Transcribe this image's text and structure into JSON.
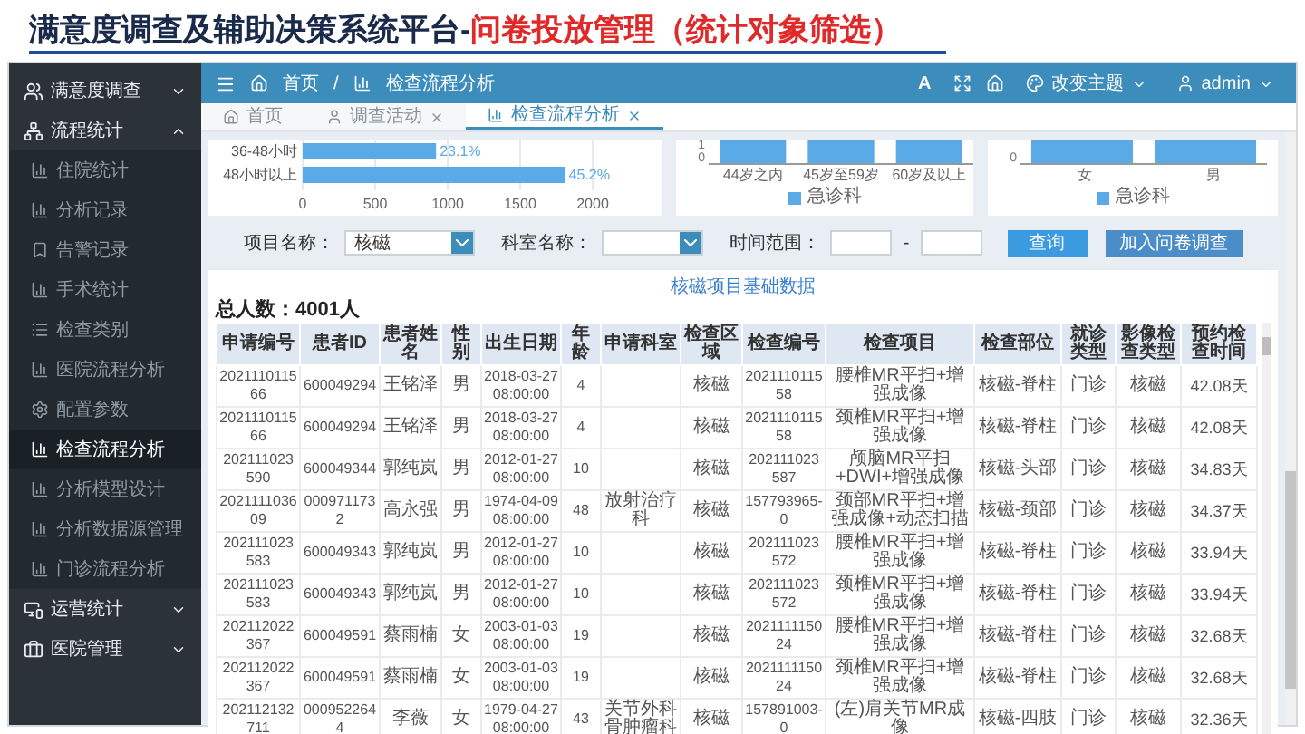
{
  "slide_title": {
    "text": "满意度调查及辅助决策系统平台-",
    "highlight": "问卷投放管理（统计对象筛选）"
  },
  "sidebar": {
    "items": [
      {
        "label": "满意度调查",
        "expanded": false
      },
      {
        "label": "流程统计",
        "expanded": true,
        "children": [
          {
            "label": "住院统计",
            "selected": false
          },
          {
            "label": "分析记录",
            "selected": false
          },
          {
            "label": "告警记录",
            "selected": false
          },
          {
            "label": "手术统计",
            "selected": false
          },
          {
            "label": "检查类别",
            "selected": false
          },
          {
            "label": "医院流程分析",
            "selected": false
          },
          {
            "label": "配置参数",
            "selected": false
          },
          {
            "label": "检查流程分析",
            "selected": true
          },
          {
            "label": "分析模型设计",
            "selected": false
          },
          {
            "label": "分析数据源管理",
            "selected": false
          },
          {
            "label": "门诊流程分析",
            "selected": false
          }
        ]
      },
      {
        "label": "运营统计",
        "expanded": false
      },
      {
        "label": "医院管理",
        "expanded": false
      }
    ]
  },
  "header": {
    "breadcrumb": [
      "首页",
      "检查流程分析"
    ],
    "separator": "/",
    "font_button": "A",
    "theme_menu": "改变主题",
    "user_menu": "admin"
  },
  "tabs": [
    {
      "label": "首页",
      "selected": false,
      "closable": false
    },
    {
      "label": "调查活动",
      "selected": false,
      "closable": true
    },
    {
      "label": "检查流程分析",
      "selected": true,
      "closable": true
    }
  ],
  "duration_chart": {
    "bar_labels": [
      "23.1%",
      "45.2%"
    ],
    "chart_data": {
      "type": "bar",
      "orientation": "horizontal",
      "grid": true,
      "categories": [
        "36-48小时",
        "48小时以上"
      ],
      "values": [
        920,
        1810
      ],
      "xlim": [
        0,
        2000
      ],
      "xticks": [
        0,
        500,
        1000,
        1500,
        2000
      ]
    }
  },
  "age_chart": {
    "axis_labels": [
      "1",
      "0"
    ],
    "categories": [
      "44岁之内",
      "45岁至59岁",
      "60岁及以上"
    ],
    "legend": "急诊科"
  },
  "sex_chart": {
    "axis_labels": [
      "0"
    ],
    "categories": [
      "女",
      "男"
    ],
    "legend": "急诊科"
  },
  "filters": {
    "project_label": "项目名称：",
    "project_value": "核磁",
    "dept_label": "科室名称：",
    "time_label": "时间范围：",
    "time_separator": "-",
    "search_button": "查询",
    "add_button": "加入问卷调查"
  },
  "table": {
    "title": "核磁项目基础数据",
    "total": "总人数：4001人",
    "columns": [
      "申请编号",
      "患者ID",
      "患者姓名",
      "性别",
      "出生日期",
      "年龄",
      "申请科室",
      "检查区域",
      "检查编号",
      "检查项目",
      "检查部位",
      "就诊类型",
      "影像检查类型",
      "预约检查时间"
    ],
    "rows": [
      {
        "request_no": "202111011566",
        "patient_id": "600049294",
        "name": "王铭泽",
        "sex": "男",
        "birth": "2018-03-27 08:00:00",
        "age": "4",
        "area": "核磁",
        "exam_no": "202111011558",
        "item": "腰椎MR平扫+增强成像",
        "part": "核磁-脊柱",
        "visit_type": "门诊",
        "modality": "核磁",
        "wait": "42.08天"
      },
      {
        "request_no": "202111011566",
        "patient_id": "600049294",
        "name": "王铭泽",
        "sex": "男",
        "birth": "2018-03-27 08:00:00",
        "age": "4",
        "area": "核磁",
        "exam_no": "202111011558",
        "item": "颈椎MR平扫+增强成像",
        "part": "核磁-脊柱",
        "visit_type": "门诊",
        "modality": "核磁",
        "wait": "42.08天"
      },
      {
        "request_no": "202111023590",
        "patient_id": "600049344",
        "name": "郭纯岚",
        "sex": "男",
        "birth": "2012-01-27 08:00:00",
        "age": "10",
        "area": "核磁",
        "exam_no": "202111023587",
        "item": "颅脑MR平扫+DWI+增强成像",
        "part": "核磁-头部",
        "visit_type": "门诊",
        "modality": "核磁",
        "wait": "34.83天"
      },
      {
        "request_no": "202111103609",
        "patient_id": "0009711732",
        "name": "高永强",
        "sex": "男",
        "birth": "1974-04-09 08:00:00",
        "age": "48",
        "dept": "放射治疗科",
        "area": "核磁",
        "exam_no": "157793965-0",
        "item": "颈部MR平扫+增强成像+动态扫描",
        "part": "核磁-颈部",
        "visit_type": "门诊",
        "modality": "核磁",
        "wait": "34.37天"
      },
      {
        "request_no": "202111023583",
        "patient_id": "600049343",
        "name": "郭纯岚",
        "sex": "男",
        "birth": "2012-01-27 08:00:00",
        "age": "10",
        "area": "核磁",
        "exam_no": "202111023572",
        "item": "腰椎MR平扫+增强成像",
        "part": "核磁-脊柱",
        "visit_type": "门诊",
        "modality": "核磁",
        "wait": "33.94天"
      },
      {
        "request_no": "202111023583",
        "patient_id": "600049343",
        "name": "郭纯岚",
        "sex": "男",
        "birth": "2012-01-27 08:00:00",
        "age": "10",
        "area": "核磁",
        "exam_no": "202111023572",
        "item": "颈椎MR平扫+增强成像",
        "part": "核磁-脊柱",
        "visit_type": "门诊",
        "modality": "核磁",
        "wait": "33.94天"
      },
      {
        "request_no": "202112022367",
        "patient_id": "600049591",
        "name": "蔡雨楠",
        "sex": "女",
        "birth": "2003-01-03 08:00:00",
        "age": "19",
        "area": "核磁",
        "exam_no": "202111115024",
        "item": "腰椎MR平扫+增强成像",
        "part": "核磁-脊柱",
        "visit_type": "门诊",
        "modality": "核磁",
        "wait": "32.68天"
      },
      {
        "request_no": "202112022367",
        "patient_id": "600049591",
        "name": "蔡雨楠",
        "sex": "女",
        "birth": "2003-01-03 08:00:00",
        "age": "19",
        "area": "核磁",
        "exam_no": "202111115024",
        "item": "颈椎MR平扫+增强成像",
        "part": "核磁-脊柱",
        "visit_type": "门诊",
        "modality": "核磁",
        "wait": "32.68天"
      },
      {
        "request_no": "202112132711",
        "patient_id": "0009522644",
        "name": "李薇",
        "sex": "女",
        "birth": "1979-04-27 08:00:00",
        "age": "43",
        "dept": "关节外科骨肿瘤科",
        "area": "核磁",
        "exam_no": "157891003-0",
        "item": "(左)肩关节MR成像",
        "part": "核磁-四肢",
        "visit_type": "门诊",
        "modality": "核磁",
        "wait": "32.36天"
      }
    ]
  }
}
